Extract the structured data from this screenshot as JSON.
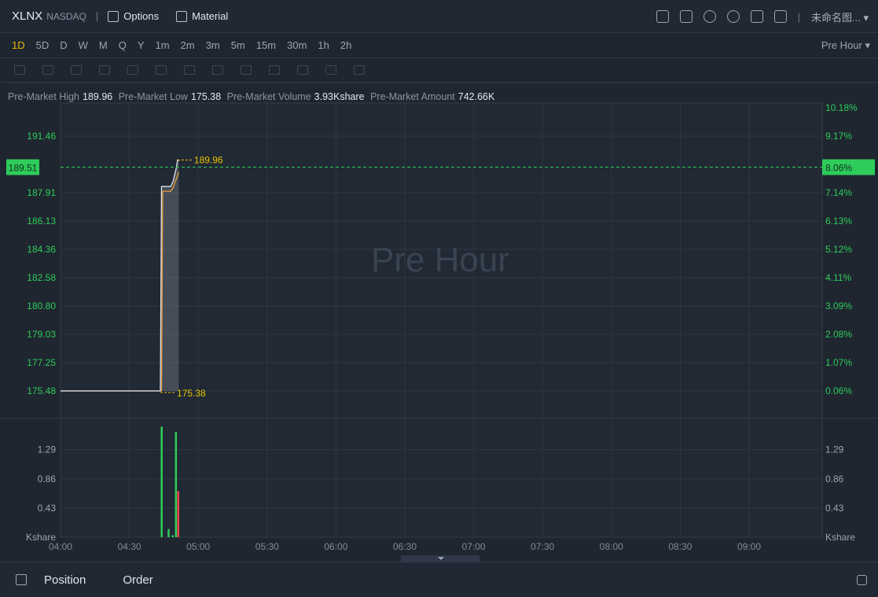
{
  "header": {
    "symbol": "XLNX",
    "exchange": "NASDAQ",
    "options_label": "Options",
    "material_label": "Material",
    "layout_name": "未命名图..."
  },
  "periods": {
    "items": [
      "1D",
      "5D",
      "D",
      "W",
      "M",
      "Q",
      "Y",
      "1m",
      "2m",
      "3m",
      "5m",
      "15m",
      "30m",
      "1h",
      "2h"
    ],
    "active": "1D",
    "session": "Pre Hour"
  },
  "stats": {
    "high_label": "Pre-Market High",
    "high": "189.96",
    "low_label": "Pre-Market Low",
    "low": "175.38",
    "volume_label": "Pre-Market Volume",
    "volume": "3.93Kshare",
    "amount_label": "Pre-Market Amount",
    "amount": "742.66K"
  },
  "watermark": "Pre Hour",
  "bottom": {
    "position_tab": "Position",
    "order_tab": "Order"
  },
  "colors": {
    "up": "#2ecc5a",
    "down": "#f04848",
    "price_line": "#f0a040",
    "highlight": "#e6c200"
  },
  "chart_data": {
    "type": "line",
    "x_ticks": [
      "04:00",
      "04:30",
      "05:00",
      "05:30",
      "06:00",
      "06:30",
      "07:00",
      "07:30",
      "08:00",
      "08:30",
      "09:00"
    ],
    "price_ticks": [
      "191.46",
      "187.91",
      "186.13",
      "184.36",
      "182.58",
      "180.80",
      "179.03",
      "177.25",
      "175.48"
    ],
    "pct_ticks": [
      "10.18%",
      "9.17%",
      "7.14%",
      "6.13%",
      "5.12%",
      "4.11%",
      "3.09%",
      "2.08%",
      "1.07%",
      "0.06%"
    ],
    "price_range": [
      175.48,
      191.46
    ],
    "current_price": "189.51",
    "current_pct": "8.06%",
    "high_label": "189.96",
    "low_label": "175.38",
    "series": [
      {
        "name": "price",
        "points": [
          [
            0,
            175.48
          ],
          [
            43.5,
            175.48
          ],
          [
            44,
            188.3
          ],
          [
            48,
            188.3
          ],
          [
            49,
            188.6
          ],
          [
            50.5,
            189.5
          ],
          [
            51,
            189.96
          ],
          [
            51.5,
            189.9
          ]
        ]
      },
      {
        "name": "avg",
        "points": [
          [
            0,
            175.48
          ],
          [
            44,
            175.48
          ],
          [
            44.5,
            188.0
          ],
          [
            48,
            188.0
          ],
          [
            49,
            188.2
          ],
          [
            51.5,
            189.2
          ]
        ]
      }
    ],
    "volume": {
      "unit": "Kshare",
      "ticks": [
        "1.29",
        "0.86",
        "0.43"
      ],
      "bars": [
        {
          "t": 44,
          "v": 1.63,
          "dir": "up"
        },
        {
          "t": 47,
          "v": 0.12,
          "dir": "up"
        },
        {
          "t": 48.8,
          "v": 0.03,
          "dir": "up"
        },
        {
          "t": 50.2,
          "v": 1.55,
          "dir": "up"
        },
        {
          "t": 51.2,
          "v": 0.68,
          "dir": "down"
        }
      ]
    }
  }
}
